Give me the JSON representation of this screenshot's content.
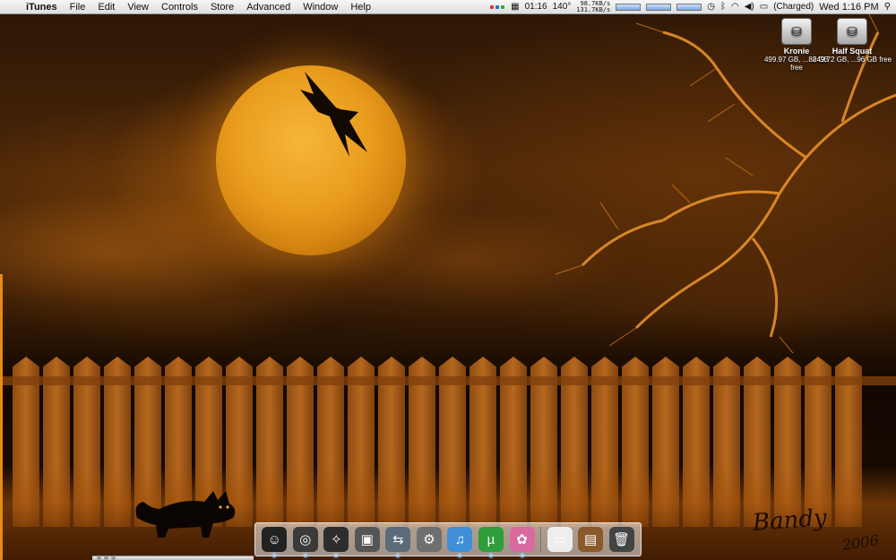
{
  "menubar": {
    "apple_glyph": "",
    "app_name": "iTunes",
    "menus": [
      "File",
      "Edit",
      "View",
      "Controls",
      "Store",
      "Advanced",
      "Window",
      "Help"
    ],
    "extras": {
      "uptime": "01:16",
      "temperature": "140°",
      "net_up": "98.7KB/s",
      "net_down": "131.7KB/s",
      "battery_status": "(Charged)",
      "clock": "Wed 1:16 PM"
    }
  },
  "desktop_icons": [
    {
      "name": "Kronie",
      "detail": "499.97 GB, ...88 GB free",
      "icon": "hard-drive-icon"
    },
    {
      "name": "Half Squat",
      "detail": "249.72 GB, ...96 GB free",
      "icon": "hard-drive-icon"
    }
  ],
  "signature": {
    "text": "Bandy",
    "year": "2006"
  },
  "dock": {
    "items": [
      {
        "name": "finder",
        "glyph": "☺",
        "color": "#222",
        "running": true
      },
      {
        "name": "dashboard",
        "glyph": "◎",
        "color": "#3a3a3a",
        "running": true
      },
      {
        "name": "safari",
        "glyph": "✧",
        "color": "#2d2d2d",
        "running": true
      },
      {
        "name": "preview",
        "glyph": "▣",
        "color": "#555",
        "running": false
      },
      {
        "name": "airport-utility",
        "glyph": "⇆",
        "color": "#5b6b7a",
        "running": true
      },
      {
        "name": "system-preferences",
        "glyph": "⚙",
        "color": "#6f6f6f",
        "running": false
      },
      {
        "name": "itunes",
        "glyph": "♫",
        "color": "#3f8fd8",
        "running": true
      },
      {
        "name": "utorrent",
        "glyph": "µ",
        "color": "#2e9e3a",
        "running": true
      },
      {
        "name": "adium",
        "glyph": "✿",
        "color": "#d86aa0",
        "running": true
      }
    ],
    "right_items": [
      {
        "name": "documents",
        "glyph": "▭",
        "color": "#eeeeee"
      },
      {
        "name": "pictures",
        "glyph": "▤",
        "color": "#8a5a2a"
      },
      {
        "name": "trash",
        "glyph": "🗑",
        "color": "#444444"
      }
    ]
  }
}
